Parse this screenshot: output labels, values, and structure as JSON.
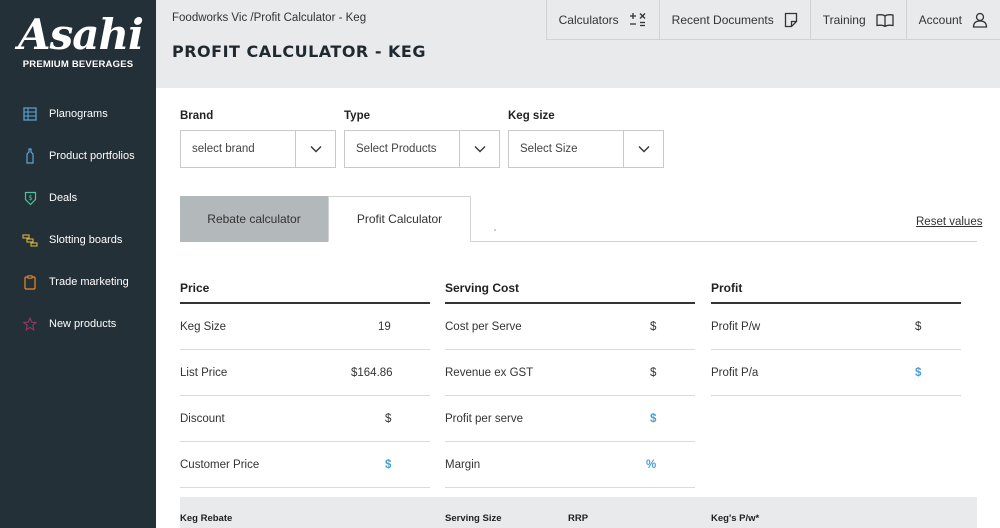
{
  "brand": {
    "logo_word": "Asahi",
    "logo_sub": "PREMIUM BEVERAGES"
  },
  "sidebar": {
    "items": [
      {
        "label": "Planograms",
        "icon": "grid-icon",
        "color": "#5aa7d8"
      },
      {
        "label": "Product portfolios",
        "icon": "bottle-icon",
        "color": "#5aa7d8"
      },
      {
        "label": "Deals",
        "icon": "shield-dollar-icon",
        "color": "#4fc3a1"
      },
      {
        "label": "Slotting boards",
        "icon": "steps-icon",
        "color": "#d8b13a"
      },
      {
        "label": "Trade marketing",
        "icon": "clipboard-icon",
        "color": "#e98a2c"
      },
      {
        "label": "New products",
        "icon": "star-icon",
        "color": "#8e3b5f"
      }
    ]
  },
  "header": {
    "breadcrumb": "Foodworks Vic /Profit Calculator - Keg",
    "title": "PROFIT CALCULATOR - KEG",
    "nav": [
      {
        "label": "Calculators",
        "icon": "calculator-icon"
      },
      {
        "label": "Recent Documents",
        "icon": "document-icon"
      },
      {
        "label": "Training",
        "icon": "book-icon"
      },
      {
        "label": "Account",
        "icon": "user-icon"
      }
    ]
  },
  "filters": {
    "brand": {
      "label": "Brand",
      "value": "select brand"
    },
    "type": {
      "label": "Type",
      "value": "Select Products"
    },
    "keg_size": {
      "label": "Keg size",
      "value": "Select Size"
    }
  },
  "tabs": {
    "rebate": "Rebate calculator",
    "profit": "Profit Calculator",
    "reset": "Reset values"
  },
  "price": {
    "heading": "Price",
    "rows": [
      {
        "label": "Keg Size",
        "value": "19"
      },
      {
        "label": "List Price",
        "value": "$164.86"
      },
      {
        "label": "Discount",
        "value": "$"
      },
      {
        "label": "Customer Price",
        "value": "$"
      }
    ]
  },
  "serving": {
    "heading": "Serving Cost",
    "rows": [
      {
        "label": "Cost per Serve",
        "value": "$"
      },
      {
        "label": "Revenue ex GST",
        "value": "$"
      },
      {
        "label": "Profit per serve",
        "value": "$"
      },
      {
        "label": "Margin",
        "value": "%"
      }
    ]
  },
  "profit": {
    "heading": "Profit",
    "rows": [
      {
        "label": "Profit P/w",
        "value": "$"
      },
      {
        "label": "Profit P/a",
        "value": "$"
      }
    ]
  },
  "bottom": {
    "keg_rebate": "Keg Rebate",
    "serving_size": "Serving Size",
    "rrp": "RRP",
    "kegs_pw": "Keg's P/w*"
  },
  "colors": {
    "sidebar_bg": "#243037",
    "header_bg": "#e8eaeb",
    "accent_blue": "#4a9fd1",
    "tab_inactive": "#b3b8bb"
  }
}
